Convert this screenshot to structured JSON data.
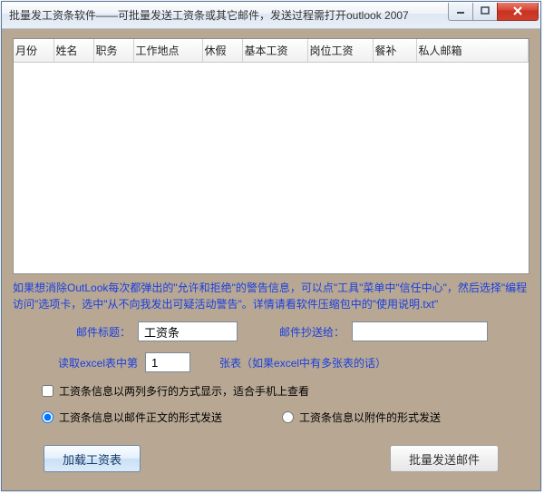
{
  "window": {
    "title": "批量发工资条软件——可批量发送工资条或其它邮件，发送过程需打开outlook 2007"
  },
  "grid": {
    "columns": [
      "月份",
      "姓名",
      "职务",
      "工作地点",
      "休假",
      "基本工资",
      "岗位工资",
      "餐补",
      "私人邮箱"
    ]
  },
  "hint_text": "如果想消除OutLook每次都弹出的\"允许和拒绝\"的警告信息，可以点\"工具\"菜单中\"信任中心\"，然后选择\"编程访问\"选项卡，选中\"从不向我发出可疑活动警告\"。详情请看软件压缩包中的\"使用说明.txt\"",
  "form": {
    "subject_label": "邮件标题：",
    "subject_value": "工资条",
    "cc_label": "邮件抄送给：",
    "cc_value": "",
    "sheet_label_left": "读取excel表中第",
    "sheet_value": "1",
    "sheet_label_right": "张表（如果excel中有多张表的话）",
    "checkbox_multiline": "工资条信息以两列多行的方式显示，适合手机上查看",
    "radio_body": "工资条信息以邮件正文的形式发送",
    "radio_attachment": "工资条信息以附件的形式发送"
  },
  "buttons": {
    "load": "加载工资表",
    "send": "批量发送邮件"
  }
}
